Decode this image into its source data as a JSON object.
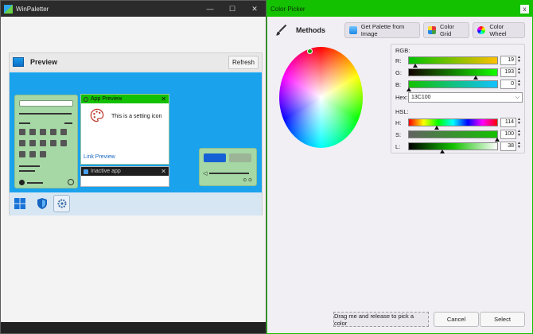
{
  "left_window": {
    "title": "WinPaletter",
    "controls": {
      "minimize": "—",
      "maximize": "☐",
      "close": "✕"
    },
    "preview": {
      "title": "Preview",
      "refresh_label": "Refresh",
      "app_preview": {
        "title": "App Preview",
        "close": "✕",
        "setting_text": "This is a setting icon",
        "link": "Link Preview"
      },
      "inactive_app": {
        "title": "Inactive app",
        "close": "✕"
      },
      "quick_settings": {
        "volume_icon": "◁",
        "dots": "⊙ ⊙"
      },
      "colors": {
        "desktop": "#1aa2ec",
        "active_titlebar": "#13c100",
        "start_menu": "#a6d8a5",
        "taskbar": "#d7e6f3"
      }
    }
  },
  "right_window": {
    "title": "Color Picker",
    "close": "x",
    "methods_label": "Methods",
    "buttons": {
      "palette_from_image": "Get Palette from Image",
      "color_grid": "Color Grid",
      "color_wheel": "Color Wheel"
    },
    "rgb_label": "RGB:",
    "hsl_label": "HSL:",
    "rgb": [
      {
        "label": "R:",
        "value": "19",
        "fraction": 0.075
      },
      {
        "label": "G:",
        "value": "193",
        "fraction": 0.757
      },
      {
        "label": "B:",
        "value": "0",
        "fraction": 0.0
      }
    ],
    "hex_label": "Hex:",
    "hex_value": "13C100",
    "hsl": [
      {
        "label": "H:",
        "value": "114",
        "fraction": 0.317
      },
      {
        "label": "S:",
        "value": "100",
        "fraction": 1.0
      },
      {
        "label": "L:",
        "value": "38",
        "fraction": 0.38
      }
    ],
    "drag_label": "Drag me and release to pick a color",
    "cancel_label": "Cancel",
    "select_label": "Select",
    "accent": "#13c100"
  }
}
